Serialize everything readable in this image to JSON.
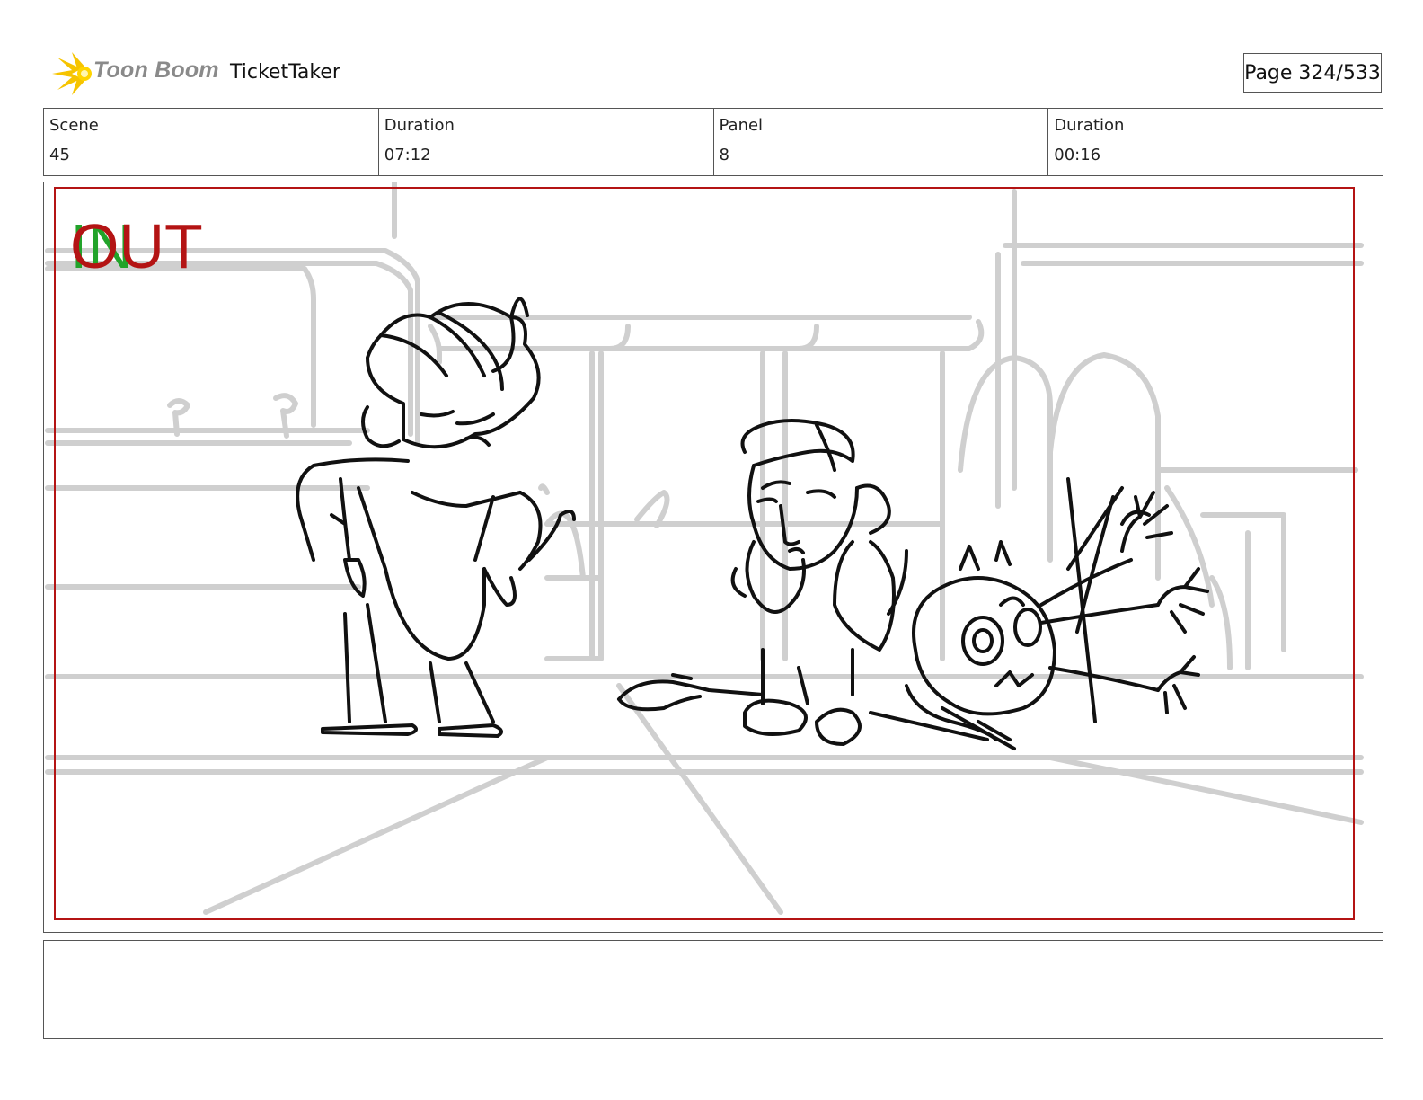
{
  "header": {
    "logo_text": "Toon Boom",
    "project_title": "TicketTaker",
    "page_label": "Page 324/533"
  },
  "info": {
    "scene_label": "Scene",
    "scene_value": "45",
    "duration_label": "Duration",
    "duration_value": "07:12",
    "panel_label": "Panel",
    "panel_value": "8",
    "panel_duration_label": "Duration",
    "panel_duration_value": "00:16"
  },
  "panel_image": {
    "in_marker": "IN",
    "out_marker": "OUT",
    "in_color": "#22a32a",
    "out_color": "#b41414",
    "safe_frame_color": "#b41414"
  },
  "notes": {
    "text": ""
  }
}
